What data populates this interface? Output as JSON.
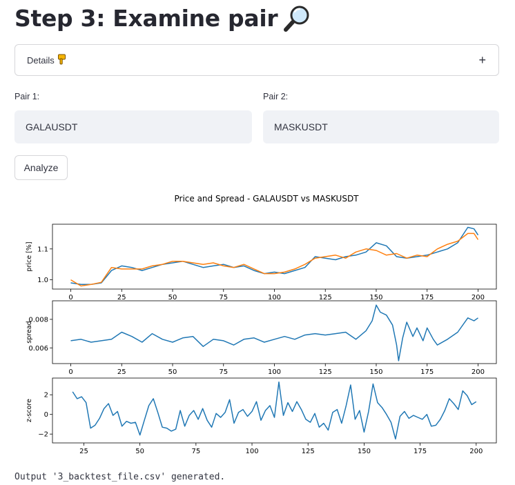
{
  "page": {
    "title": "Step 3: Examine pair",
    "title_icon": "magnifying-glass-icon",
    "expander": {
      "label": "Details",
      "icon": "pointing-down-hand-icon",
      "toggle": "+"
    },
    "pair1": {
      "label": "Pair 1:",
      "value": "GALAUSDT"
    },
    "pair2": {
      "label": "Pair 2:",
      "value": "MASKUSDT"
    },
    "analyze_label": "Analyze",
    "output_text": "Output '3_backtest_file.csv' generated."
  },
  "colors": {
    "series_blue": "#1f77b4",
    "series_orange": "#ff7f0e",
    "input_bg": "#f0f2f6"
  },
  "chart_data": [
    {
      "type": "line",
      "title": "Price and Spread - GALAUSDT vs MASKUSDT",
      "ylabel": "price [%]",
      "xlim": [
        -9,
        209
      ],
      "ylim": [
        0.97,
        1.18
      ],
      "xticks": [
        0,
        25,
        50,
        75,
        100,
        125,
        150,
        175,
        200
      ],
      "yticks": [
        1.0,
        1.1
      ],
      "ytick_labels": [
        "1.0",
        "1.1"
      ],
      "series": [
        {
          "color": "#1f77b4",
          "x": [
            0,
            5,
            10,
            15,
            20,
            25,
            30,
            35,
            40,
            45,
            50,
            55,
            60,
            65,
            70,
            75,
            80,
            85,
            90,
            95,
            100,
            105,
            110,
            115,
            120,
            125,
            130,
            135,
            140,
            145,
            150,
            155,
            160,
            165,
            170,
            175,
            180,
            185,
            190,
            195,
            198,
            200
          ],
          "y": [
            0.99,
            0.985,
            0.985,
            0.99,
            1.03,
            1.045,
            1.04,
            1.03,
            1.04,
            1.05,
            1.055,
            1.06,
            1.05,
            1.04,
            1.045,
            1.05,
            1.04,
            1.045,
            1.03,
            1.02,
            1.025,
            1.02,
            1.03,
            1.04,
            1.075,
            1.07,
            1.065,
            1.075,
            1.08,
            1.09,
            1.12,
            1.11,
            1.075,
            1.07,
            1.075,
            1.08,
            1.09,
            1.1,
            1.12,
            1.17,
            1.165,
            1.145
          ]
        },
        {
          "color": "#ff7f0e",
          "x": [
            0,
            5,
            10,
            15,
            20,
            25,
            30,
            35,
            40,
            45,
            50,
            55,
            60,
            65,
            70,
            75,
            80,
            85,
            90,
            95,
            100,
            105,
            110,
            115,
            120,
            125,
            130,
            135,
            140,
            145,
            150,
            155,
            160,
            165,
            170,
            175,
            180,
            185,
            190,
            195,
            198,
            200
          ],
          "y": [
            1.0,
            0.98,
            0.985,
            0.992,
            1.04,
            1.035,
            1.035,
            1.035,
            1.045,
            1.05,
            1.06,
            1.06,
            1.055,
            1.05,
            1.055,
            1.045,
            1.04,
            1.05,
            1.035,
            1.02,
            1.02,
            1.025,
            1.035,
            1.05,
            1.07,
            1.075,
            1.08,
            1.07,
            1.09,
            1.1,
            1.095,
            1.08,
            1.085,
            1.07,
            1.08,
            1.075,
            1.1,
            1.115,
            1.125,
            1.15,
            1.15,
            1.13
          ]
        }
      ]
    },
    {
      "type": "line",
      "ylabel": "spread",
      "xlim": [
        -9,
        209
      ],
      "ylim": [
        0.0049,
        0.0093
      ],
      "xticks": [
        0,
        25,
        50,
        75,
        100,
        125,
        150,
        175,
        200
      ],
      "yticks": [
        0.006,
        0.008
      ],
      "ytick_labels": [
        "0.006",
        "0.008"
      ],
      "series": [
        {
          "color": "#1f77b4",
          "x": [
            0,
            5,
            10,
            15,
            20,
            25,
            30,
            35,
            40,
            45,
            50,
            55,
            60,
            65,
            70,
            75,
            80,
            85,
            90,
            95,
            100,
            105,
            110,
            115,
            120,
            125,
            130,
            135,
            140,
            145,
            148,
            150,
            152,
            155,
            158,
            160,
            161,
            163,
            165,
            168,
            170,
            173,
            175,
            178,
            180,
            185,
            190,
            195,
            198,
            200
          ],
          "y": [
            0.0065,
            0.0066,
            0.0064,
            0.0065,
            0.0066,
            0.0071,
            0.0068,
            0.0064,
            0.007,
            0.0066,
            0.0064,
            0.0067,
            0.0068,
            0.0061,
            0.0066,
            0.0065,
            0.0062,
            0.0066,
            0.0067,
            0.0064,
            0.0066,
            0.0068,
            0.0066,
            0.0069,
            0.007,
            0.0069,
            0.007,
            0.0071,
            0.0066,
            0.0072,
            0.0079,
            0.009,
            0.0085,
            0.0083,
            0.0076,
            0.0062,
            0.0051,
            0.0067,
            0.0078,
            0.0068,
            0.0074,
            0.0065,
            0.0074,
            0.0066,
            0.0062,
            0.0066,
            0.0071,
            0.0081,
            0.0079,
            0.0081
          ]
        }
      ]
    },
    {
      "type": "line",
      "ylabel": "z-score",
      "xlim": [
        11,
        209
      ],
      "ylim": [
        -2.9,
        3.7
      ],
      "xticks": [
        25,
        50,
        75,
        100,
        125,
        150,
        175,
        200
      ],
      "yticks": [
        -2,
        0,
        2
      ],
      "ytick_labels": [
        "−2",
        "0",
        "2"
      ],
      "series": [
        {
          "color": "#1f77b4",
          "x": [
            20,
            22,
            24,
            26,
            28,
            30,
            32,
            34,
            36,
            38,
            40,
            42,
            44,
            46,
            48,
            50,
            52,
            54,
            56,
            58,
            60,
            62,
            64,
            66,
            68,
            70,
            72,
            74,
            76,
            78,
            80,
            82,
            84,
            86,
            88,
            90,
            92,
            94,
            96,
            98,
            100,
            102,
            104,
            106,
            108,
            110,
            112,
            114,
            116,
            118,
            120,
            122,
            124,
            126,
            128,
            130,
            132,
            134,
            136,
            138,
            140,
            142,
            144,
            146,
            148,
            150,
            152,
            154,
            156,
            158,
            160,
            162,
            164,
            166,
            168,
            170,
            172,
            174,
            176,
            178,
            180,
            182,
            184,
            186,
            188,
            190,
            192,
            194,
            196,
            198,
            200
          ],
          "y": [
            2.3,
            1.6,
            1.8,
            1.2,
            -1.4,
            -1.1,
            -0.4,
            0.6,
            1.1,
            -0.1,
            0.3,
            -1.2,
            -0.7,
            -0.9,
            -0.8,
            -2.1,
            -0.6,
            0.9,
            1.6,
            0.2,
            -1.3,
            -1.4,
            -1.7,
            -1.5,
            0.4,
            -1.2,
            -0.1,
            0.4,
            -0.5,
            0.6,
            -0.6,
            -1.3,
            0.1,
            -0.3,
            0.2,
            1.5,
            -0.9,
            0.2,
            0.5,
            -0.2,
            0.3,
            1.3,
            -0.6,
            0.4,
            0.9,
            -0.3,
            3.3,
            -0.1,
            1.2,
            0.3,
            1.3,
            0.5,
            -0.5,
            -0.8,
            0.1,
            -1.3,
            -0.9,
            -1.6,
            0.2,
            0.5,
            -0.9,
            0.9,
            3.0,
            -0.5,
            0.4,
            -1.8,
            0.3,
            3.1,
            1.2,
            0.7,
            0.0,
            -0.8,
            -2.5,
            -0.2,
            0.3,
            -0.4,
            -0.1,
            -0.3,
            -0.5,
            0.0,
            -1.2,
            -1.1,
            -0.5,
            0.4,
            1.6,
            1.1,
            0.5,
            2.4,
            1.9,
            1.0,
            1.3
          ]
        }
      ]
    }
  ]
}
